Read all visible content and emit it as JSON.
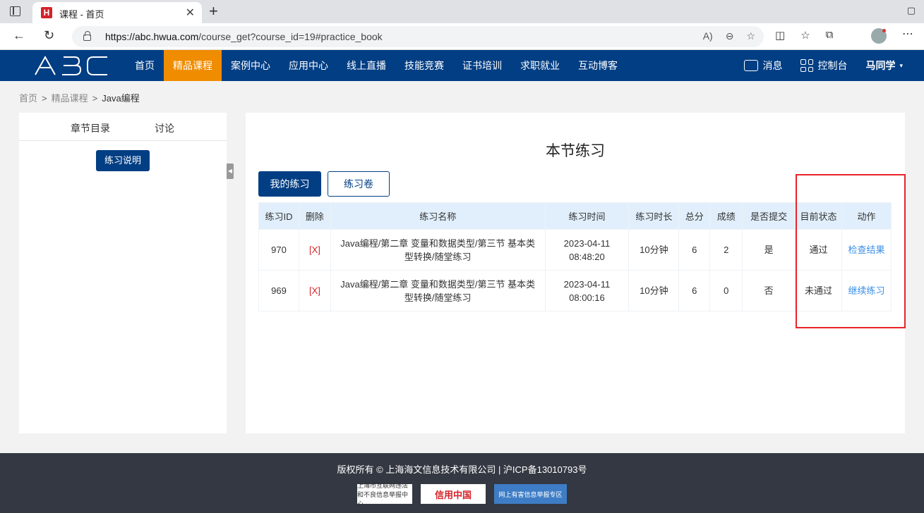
{
  "browser": {
    "tab_title": "课程 - 首页",
    "url_host": "https://abc.hwua.com",
    "url_path": "/course_get?course_id=19#practice_book"
  },
  "site": {
    "logo_text": "ABC",
    "menu": [
      "首页",
      "精品课程",
      "案例中心",
      "应用中心",
      "线上直播",
      "技能竞赛",
      "证书培训",
      "求职就业",
      "互动博客"
    ],
    "active_menu": "精品课程",
    "messages_label": "消息",
    "console_label": "控制台",
    "user_name": "马同学"
  },
  "breadcrumb": [
    "首页",
    "精品课程",
    "Java编程"
  ],
  "sidebar": {
    "tabs": [
      "章节目录",
      "讨论"
    ],
    "explain_button": "练习说明"
  },
  "main": {
    "title": "本节练习",
    "tabs": [
      "我的练习",
      "练习卷"
    ],
    "table": {
      "headers": [
        "练习ID",
        "删除",
        "练习名称",
        "练习时间",
        "练习时长",
        "总分",
        "成绩",
        "是否提交",
        "目前状态",
        "动作"
      ],
      "rows": [
        {
          "id": "970",
          "del": "[X]",
          "name": "Java编程/第二章 变量和数据类型/第三节 基本类型转换/随堂练习",
          "date": "2023-04-11",
          "time": "08:48:20",
          "duration": "10分钟",
          "total": "6",
          "score": "2",
          "submitted": "是",
          "status": "通过",
          "action": "检查结果"
        },
        {
          "id": "969",
          "del": "[X]",
          "name": "Java编程/第二章 变量和数据类型/第三节 基本类型转换/随堂练习",
          "date": "2023-04-11",
          "time": "08:00:16",
          "duration": "10分钟",
          "total": "6",
          "score": "0",
          "submitted": "否",
          "status": "未通过",
          "action": "继续练习"
        }
      ]
    }
  },
  "footer": {
    "copyright": "版权所有 © 上海海文信息技术有限公司 | 沪ICP备13010793号",
    "badges": [
      "上海市互联网违法和不良信息举报中心",
      "信用中国",
      "网上有害信息举报专区"
    ]
  },
  "colors": {
    "nav_bg": "#013e84",
    "active": "#f08c00",
    "link": "#3a8ee6",
    "delete": "#d4222a",
    "highlight": "#e8232a"
  }
}
